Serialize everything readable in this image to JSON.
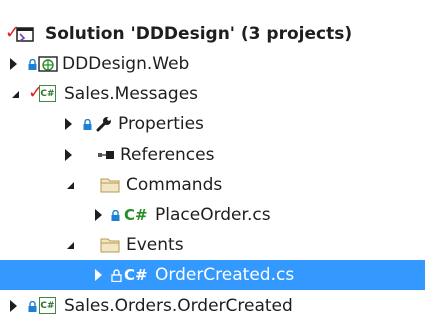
{
  "solution_explorer": {
    "items": [
      {
        "label": "Solution 'DDDesign' (3 projects)",
        "icon": "solution-icon",
        "level": 0
      },
      {
        "label": "DDDesign.Web",
        "icon": "web-project-icon",
        "level": 1,
        "expanded": false
      },
      {
        "label": "Sales.Messages",
        "icon": "csharp-project-icon",
        "level": 1,
        "expanded": true
      },
      {
        "label": "Properties",
        "icon": "wrench-icon",
        "level": 2,
        "expanded": false
      },
      {
        "label": "References",
        "icon": "references-icon",
        "level": 2,
        "expanded": false
      },
      {
        "label": "Commands",
        "icon": "folder-icon",
        "level": 2,
        "expanded": true
      },
      {
        "label": "PlaceOrder.cs",
        "icon": "csharp-file-icon",
        "level": 3,
        "expanded": false
      },
      {
        "label": "Events",
        "icon": "folder-icon",
        "level": 2,
        "expanded": true
      },
      {
        "label": "OrderCreated.cs",
        "icon": "csharp-file-icon",
        "level": 3,
        "expanded": false,
        "selected": true
      },
      {
        "label": "Sales.Orders.OrderCreated",
        "icon": "csharp-project-icon",
        "level": 1,
        "expanded": false
      }
    ]
  },
  "colors": {
    "selection": "#3399ff",
    "git_check": "#e02020",
    "lock": "#1e7fd6",
    "csharp": "#268f26",
    "folder": "#d8b56a"
  }
}
